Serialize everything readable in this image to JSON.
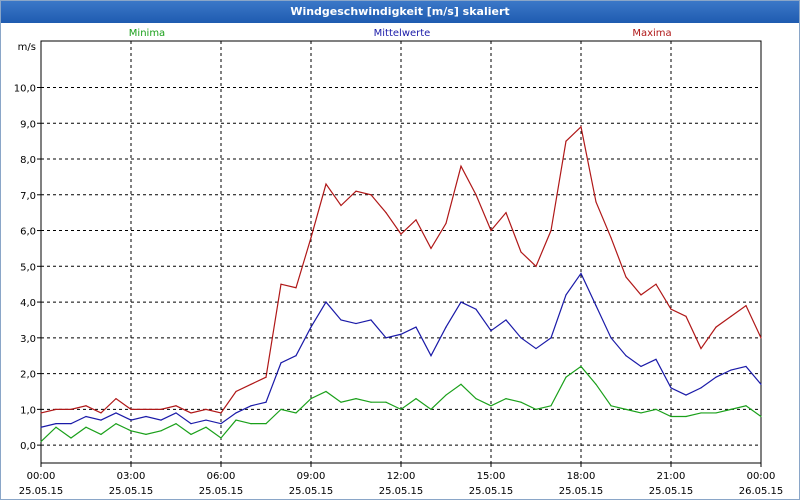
{
  "window": {
    "title": "Windgeschwindigkeit [m/s] skaliert"
  },
  "chart_data": {
    "type": "line",
    "title": "Windgeschwindigkeit [m/s] skaliert",
    "ylabel": "m/s",
    "xlabel": "",
    "ylim": [
      -0.5,
      11.3
    ],
    "xlim": [
      0,
      24
    ],
    "grid": true,
    "legend": [
      "Minima",
      "Mittelwerte",
      "Maxima"
    ],
    "yticks": [
      "0,0",
      "1,0",
      "2,0",
      "3,0",
      "4,0",
      "5,0",
      "6,0",
      "7,0",
      "8,0",
      "9,0",
      "10,0"
    ],
    "xticks": [
      {
        "time": "00:00",
        "date": "25.05.15"
      },
      {
        "time": "03:00",
        "date": "25.05.15"
      },
      {
        "time": "06:00",
        "date": "25.05.15"
      },
      {
        "time": "09:00",
        "date": "25.05.15"
      },
      {
        "time": "12:00",
        "date": "25.05.15"
      },
      {
        "time": "15:00",
        "date": "25.05.15"
      },
      {
        "time": "18:00",
        "date": "25.05.15"
      },
      {
        "time": "21:00",
        "date": "25.05.15"
      },
      {
        "time": "00:00",
        "date": "26.05.15"
      }
    ],
    "x_hours": [
      0,
      0.5,
      1,
      1.5,
      2,
      2.5,
      3,
      3.5,
      4,
      4.5,
      5,
      5.5,
      6,
      6.5,
      7,
      7.5,
      8,
      8.5,
      9,
      9.5,
      10,
      10.5,
      11,
      11.5,
      12,
      12.5,
      13,
      13.5,
      14,
      14.5,
      15,
      15.5,
      16,
      16.5,
      17,
      17.5,
      18,
      18.5,
      19,
      19.5,
      20,
      20.5,
      21,
      21.5,
      22,
      22.5,
      23,
      23.5,
      24
    ],
    "series": [
      {
        "name": "Maxima",
        "color": "#b01818",
        "values": [
          0.9,
          1.0,
          1.0,
          1.1,
          0.9,
          1.3,
          1.0,
          1.0,
          1.0,
          1.1,
          0.9,
          1.0,
          0.9,
          1.5,
          1.7,
          1.9,
          4.5,
          4.4,
          5.8,
          7.3,
          6.7,
          7.1,
          7.0,
          6.5,
          5.9,
          6.3,
          5.5,
          6.2,
          7.8,
          7.0,
          6.0,
          6.5,
          5.4,
          5.0,
          6.0,
          8.5,
          8.9,
          6.8,
          5.8,
          4.7,
          4.2,
          4.5,
          3.8,
          3.6,
          2.7,
          3.3,
          3.6,
          3.9,
          3.0
        ]
      },
      {
        "name": "Mittelwerte",
        "color": "#1a1aa8",
        "values": [
          0.5,
          0.6,
          0.6,
          0.8,
          0.7,
          0.9,
          0.7,
          0.8,
          0.7,
          0.9,
          0.6,
          0.7,
          0.6,
          0.9,
          1.1,
          1.2,
          2.3,
          2.5,
          3.3,
          4.0,
          3.5,
          3.4,
          3.5,
          3.0,
          3.1,
          3.3,
          2.5,
          3.3,
          4.0,
          3.8,
          3.2,
          3.5,
          3.0,
          2.7,
          3.0,
          4.2,
          4.8,
          3.9,
          3.0,
          2.5,
          2.2,
          2.4,
          1.6,
          1.4,
          1.6,
          1.9,
          2.1,
          2.2,
          1.7
        ]
      },
      {
        "name": "Minima",
        "color": "#1aa01a",
        "values": [
          0.1,
          0.5,
          0.2,
          0.5,
          0.3,
          0.6,
          0.4,
          0.3,
          0.4,
          0.6,
          0.3,
          0.5,
          0.2,
          0.7,
          0.6,
          0.6,
          1.0,
          0.9,
          1.3,
          1.5,
          1.2,
          1.3,
          1.2,
          1.2,
          1.0,
          1.3,
          1.0,
          1.4,
          1.7,
          1.3,
          1.1,
          1.3,
          1.2,
          1.0,
          1.1,
          1.9,
          2.2,
          1.7,
          1.1,
          1.0,
          0.9,
          1.0,
          0.8,
          0.8,
          0.9,
          0.9,
          1.0,
          1.1,
          0.8
        ]
      }
    ]
  }
}
